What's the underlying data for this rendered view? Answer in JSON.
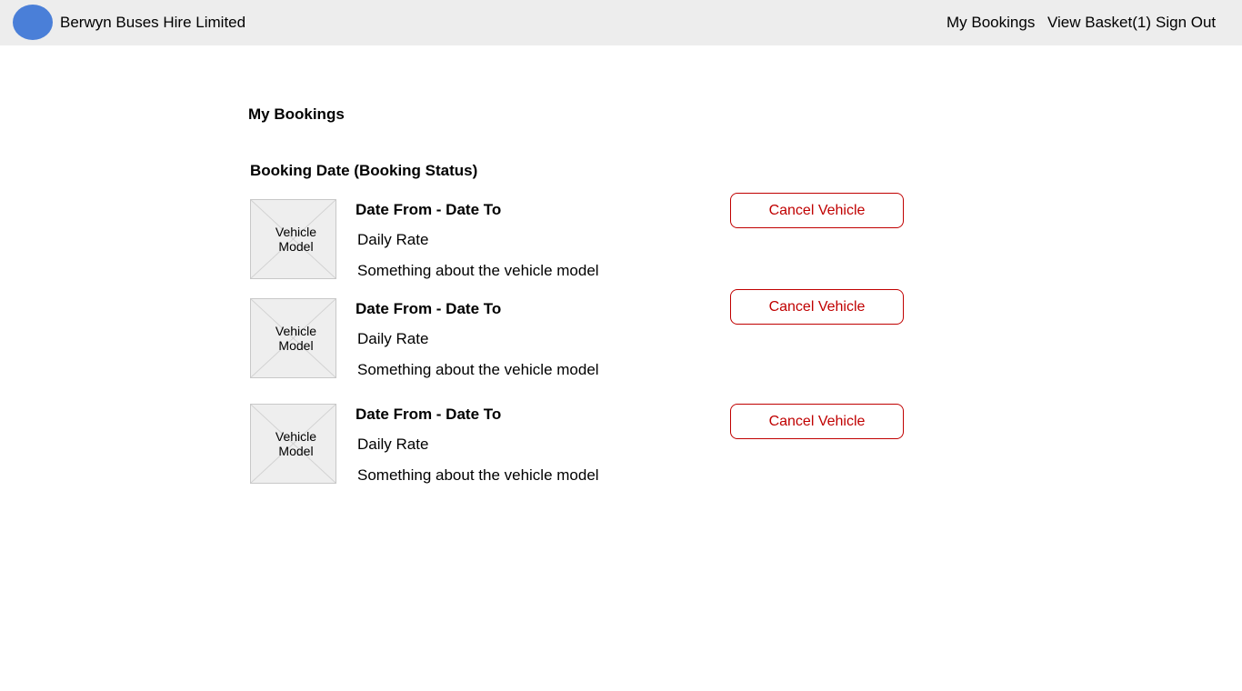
{
  "header": {
    "brand": "Berwyn Buses Hire Limited",
    "nav": {
      "my_bookings": "My Bookings",
      "view_basket": "View Basket(1)",
      "sign_out": "Sign Out"
    },
    "logo_color": "#4a7fd8"
  },
  "page": {
    "title": "My Bookings",
    "group_heading": "Booking Date (Booking Status)"
  },
  "bookings": [
    {
      "image_label": "Vehicle Model",
      "dates": "Date From - Date To",
      "rate": "Daily Rate",
      "description": "Something about the vehicle model",
      "cancel_label": "Cancel Vehicle"
    },
    {
      "image_label": "Vehicle Model",
      "dates": "Date From - Date To",
      "rate": "Daily Rate",
      "description": "Something about the vehicle model",
      "cancel_label": "Cancel Vehicle"
    },
    {
      "image_label": "Vehicle Model",
      "dates": "Date From - Date To",
      "rate": "Daily Rate",
      "description": "Something about the vehicle model",
      "cancel_label": "Cancel Vehicle"
    }
  ]
}
